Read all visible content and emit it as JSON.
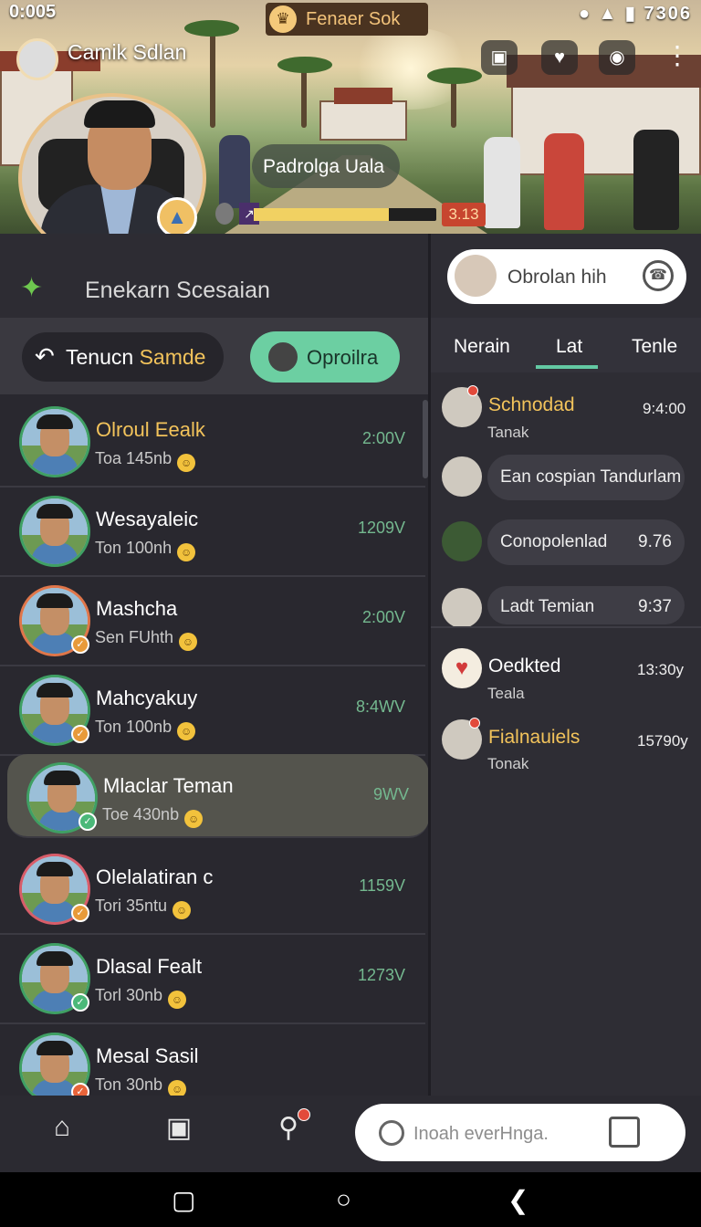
{
  "status": {
    "time": "0:005",
    "right": "7306"
  },
  "top_pill": {
    "label": "Fenaer Sok",
    "icon": "trophy-icon"
  },
  "profile": {
    "name": "Camik Sdlan"
  },
  "scene_label": "Padrolga Uala",
  "progress": {
    "fraction": 0.74,
    "level_text": "3.13"
  },
  "session": {
    "label": "Enekarn Scesaian"
  },
  "buttons": {
    "back_label": "Tenucn",
    "back_highlight": "Samde",
    "online_label": "Oproilra"
  },
  "chats": [
    {
      "name": "Olroul Eealk",
      "sub": "Toa 145nb",
      "time": "2:00V",
      "gold": true
    },
    {
      "name": "Wesayaleic",
      "sub": "Ton 100nh",
      "time": "1209V",
      "gold": false
    },
    {
      "name": "Mashcha",
      "sub": "Sen FUhth",
      "time": "2:00V",
      "gold": false
    },
    {
      "name": "Mahcyakuy",
      "sub": "Ton 100nb",
      "time": "8:4WV",
      "gold": false
    },
    {
      "name": "Mlaclar Teman",
      "sub": "Toe 430nb",
      "time": "9WV",
      "gold": false
    },
    {
      "name": "Olelalatiran c",
      "sub": "Tori 35ntu",
      "time": "1159V",
      "gold": false
    },
    {
      "name": "Dlasal Fealt",
      "sub": "Torl 30nb",
      "time": "1273V",
      "gold": false
    },
    {
      "name": "Mesal Sasil",
      "sub": "Ton 30nb",
      "time": "",
      "gold": false
    }
  ],
  "right": {
    "search_placeholder": "Obrolan hih",
    "tabs": [
      "Nerain",
      "Lat",
      "Tenle"
    ],
    "items": [
      {
        "name": "Schnodad",
        "sub": "Tanak",
        "time": "9:4:00"
      },
      {
        "bubble": "Ean cospian Tandurlam"
      },
      {
        "bubble": "Conopolenlad",
        "time": "9.76"
      },
      {
        "bubble": "Ladt Temian",
        "time": "9:37"
      },
      {
        "name": "Oedkted",
        "sub": "Teala",
        "time": "13:30y"
      },
      {
        "name": "Fialnauiels",
        "sub": "Tonak",
        "time": "15790y"
      }
    ]
  },
  "bottom": {
    "search_placeholder": "Inoah everHnga."
  }
}
